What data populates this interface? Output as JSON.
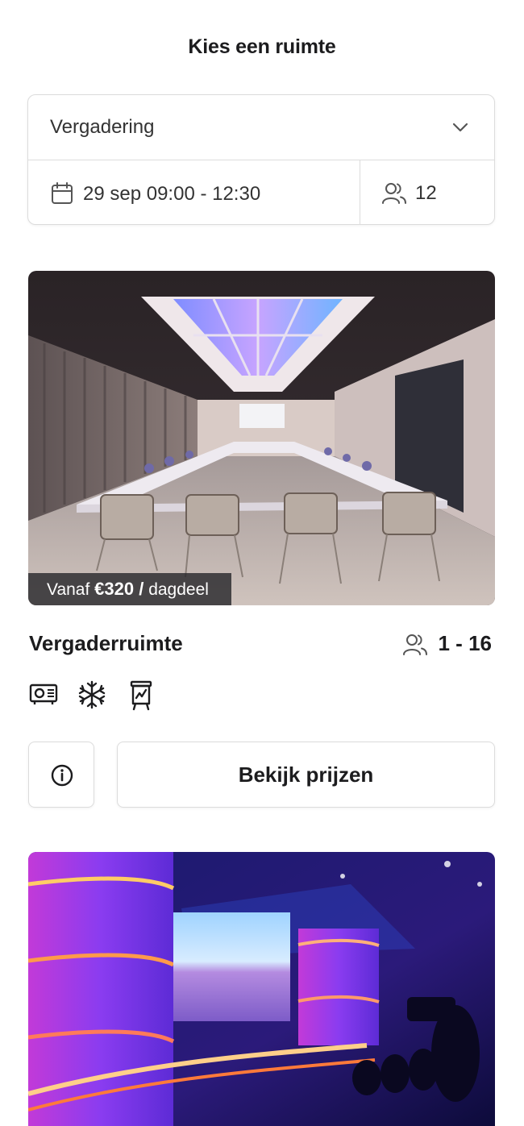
{
  "header": {
    "title": "Kies een ruimte"
  },
  "filters": {
    "type_value": "Vergadering",
    "date_value": "29 sep 09:00 - 12:30",
    "people_value": "12"
  },
  "rooms": [
    {
      "price_prefix": "Vanaf",
      "price_amount": "€320 /",
      "price_unit": "dagdeel",
      "name": "Vergaderruimte",
      "capacity": "1 - 16",
      "amenities": [
        "projector-icon",
        "snowflake-icon",
        "flipchart-icon"
      ],
      "info_icon": "info-icon",
      "action_label": "Bekijk prijzen"
    }
  ],
  "colors": {
    "text": "#1c1c1e",
    "border": "#dcdcdc",
    "price_tag_bg": "#28282c"
  }
}
